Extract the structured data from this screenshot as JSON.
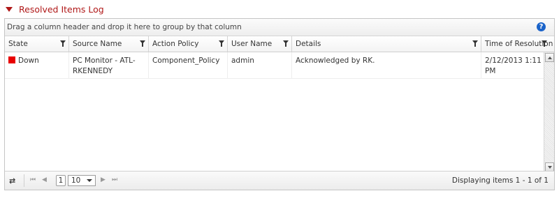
{
  "section": {
    "title": "Resolved Items Log"
  },
  "grid": {
    "group_hint": "Drag a column header and drop it here to group by that column",
    "help_label": "?",
    "columns": [
      {
        "label": "State"
      },
      {
        "label": "Source Name"
      },
      {
        "label": "Action Policy"
      },
      {
        "label": "User Name"
      },
      {
        "label": "Details"
      },
      {
        "label": "Time of Resolution"
      }
    ],
    "rows": [
      {
        "state": "Down",
        "state_color": "#e80000",
        "source_name": "PC Monitor - ATL-RKENNEDY",
        "action_policy": "Component_Policy",
        "user_name": "admin",
        "details": "Acknowledged by RK.",
        "time_of_resolution": "2/12/2013 1:11 PM"
      }
    ]
  },
  "pager": {
    "refresh_icon": "refresh-icon",
    "first": "⏮",
    "prev": "◀",
    "next": "▶",
    "last": "⏭",
    "current_page": "1",
    "page_size": "10",
    "status": "Displaying items 1 - 1 of 1"
  },
  "colors": {
    "accent": "#b01818",
    "help": "#1a63c9",
    "state_down": "#e80000"
  }
}
